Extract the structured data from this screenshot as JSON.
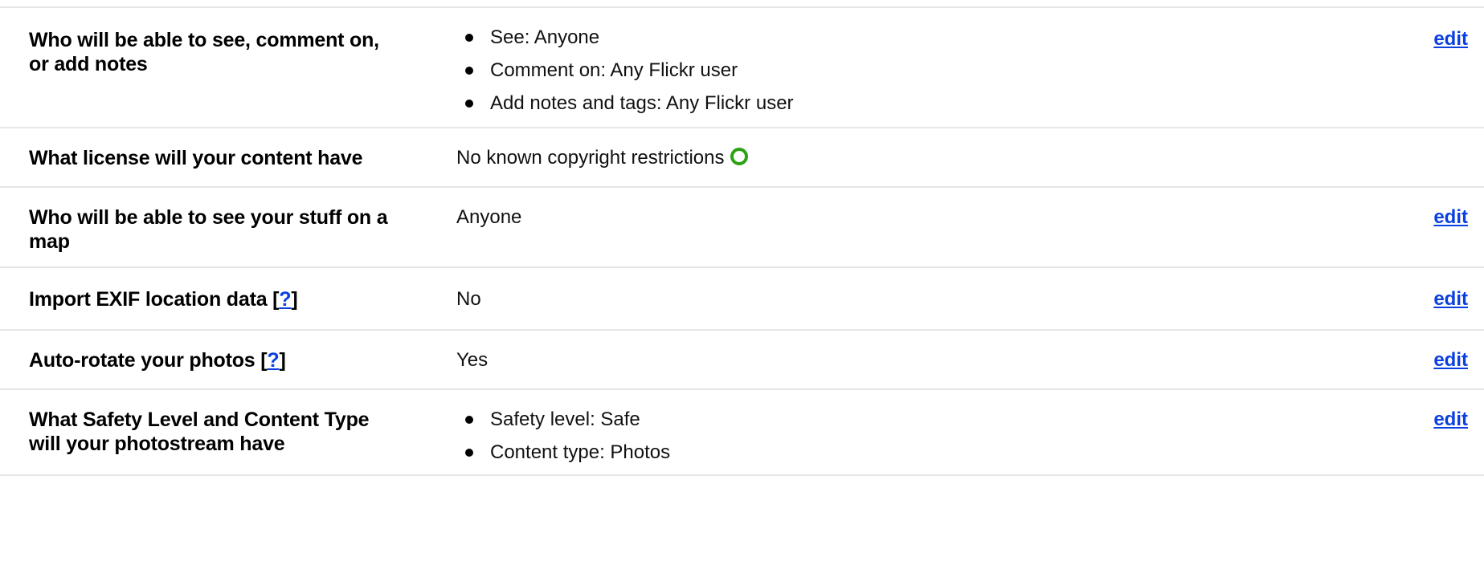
{
  "rows": [
    {
      "label": "Who will be able to see, comment on, or add notes",
      "values": [
        "See: Anyone",
        "Comment on: Any Flickr user",
        "Add notes and tags: Any Flickr user"
      ],
      "edit_label": "edit"
    },
    {
      "label": "What license will your content have",
      "value": "No known copyright restrictions",
      "icon": "no-known-copyright-icon"
    },
    {
      "label": "Who will be able to see your stuff on a map",
      "value": "Anyone",
      "edit_label": "edit"
    },
    {
      "label": "Import EXIF location data [",
      "help_link": "?",
      "label_suffix": "]",
      "value": "No",
      "edit_label": "edit"
    },
    {
      "label": "Auto-rotate your photos [",
      "help_link": "?",
      "label_suffix": "]",
      "value": "Yes",
      "edit_label": "edit"
    },
    {
      "label": "What Safety Level and Content Type will your photostream have",
      "values": [
        "Safety level: Safe",
        "Content type: Photos"
      ],
      "edit_label": "edit"
    }
  ],
  "colors": {
    "link": "#0a3fe0",
    "license_icon": "#2aa214",
    "divider": "#e6e6e6"
  }
}
